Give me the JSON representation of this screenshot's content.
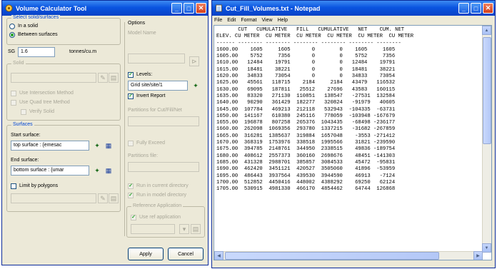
{
  "dialog": {
    "title": "Volume Calculator Tool",
    "select_group_title": "Select solid/surfaces",
    "radio_in_solid": "In a solid",
    "radio_between_surfaces": "Between surfaces",
    "sg_label": "SG",
    "sg_value": "1.6",
    "sg_unit": "tonnes/cu.m",
    "solid_group_title": "Solid",
    "use_intersection": "Use Intersection Method",
    "use_quad_tree": "Use Quad tree Method",
    "verify_solid": "Verify Solid",
    "surfaces_group_title": "Surfaces",
    "start_surface_label": "Start surface:",
    "start_surface_value": "top surface : {emesac",
    "end_surface_label": "End surface:",
    "end_surface_value": "bottom surface : {umar",
    "limit_by_polygons": "Limit by polygons",
    "options_title": "Options",
    "model_name_label": "Model Name",
    "levels_label": "Levels:",
    "levels_value": "Grid site/site/1",
    "invert_report": "Invert Report",
    "partitions_label": "Partitions for Cut/Fill/Net",
    "fully_exceed": "Fully Exceed",
    "partitions_file_label": "Partitions file:",
    "run_current": "Run in current directory",
    "run_model": "Run in model directory",
    "reference_title": "Reference Application",
    "use_reference": "Use ref application",
    "apply_label": "Apply",
    "cancel_label": "Cancel"
  },
  "notepad": {
    "title": "Cut_Fill_Volumes.txt - Notepad",
    "menu": [
      "File",
      "Edit",
      "Format",
      "View",
      "Help"
    ],
    "header_line1": "       CUT   CUMULATIVE   FILL   CUMULATIVE   NET    CUM. NET",
    "header_line2": "ELEV. CU METER  CU METER  CU METER  CU METER  CU METER  CU METER",
    "header_line3": "------ -------- -------- -------- -------- -------- --------",
    "rows": [
      "1600.00    1605     1605       0        0    1605     1605",
      "1605.00    5752     7356       0        0    5752     7356",
      "1610.00   12484    19791       0        0   12484    19791",
      "1615.00   18481    38221       0        0   18481    38221",
      "1620.00   34833    73054       0        0   34833    73054",
      "1625.00   45561   118715    2184     2184   43479   116532",
      "1630.00   69095   187811   25512    27696   43583   160115",
      "1635.00   83320   271130  110851   138547   -27531  132584",
      "1640.00   90290   361429  182277   320824   -91979   40605",
      "1645.00  107784   469213  212118   532943  -104335  -63731",
      "1650.00  141167   610380  245116   778059  -103948 -167679",
      "1655.00  196878   807258  265376  1043435   -68498 -236177",
      "1660.00  262098  1069356  293780  1337215   -31682 -267859",
      "1665.00  316281  1385637  319884  1657048    -3553 -271412",
      "1670.00  368319  1753976  338518  1995566    31821 -239590",
      "1675.00  394785  2148761  344950  2338515    49836 -189754",
      "1680.00  408612  2557373  360160  2698676    48451 -141303",
      "1685.00  431328  2988701  385857  3084533    45472  -95831",
      "1690.00  462420  3451121  420527  3505060    41896  -53959",
      "1695.00  486443  3937564  439530  3944590    46913   -7124",
      "1700.00  512852  4450416  448002  4388292    69250   62124",
      "1705.00  530915  4981330  466170  4854462    64744  126868"
    ]
  }
}
